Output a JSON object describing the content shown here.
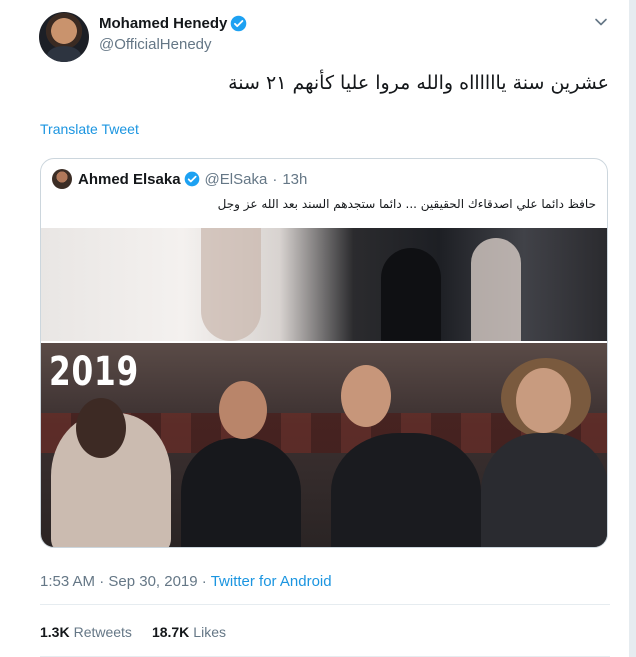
{
  "author": {
    "display_name": "Mohamed Henedy",
    "handle": "@OfficialHenedy",
    "verified_icon": "verified-badge-icon"
  },
  "tweet": {
    "text": "عشرين سنة يااااااه والله مروا عليا كأنهم ٢١ سنة",
    "translate_label": "Translate Tweet"
  },
  "quoted_tweet": {
    "display_name": "Ahmed Elsaka",
    "handle": "@ElSaka",
    "separator": "·",
    "time": "13h",
    "text": "حافظ دائما علي اصدقاءك الحقيقين ... دائما ستجدهم  السند بعد الله عز وجل",
    "media_caption": "2019"
  },
  "meta": {
    "timestamp": "1:53 AM · Sep 30, 2019",
    "separator": "·",
    "source": "Twitter for Android"
  },
  "stats": {
    "retweets_count": "1.3K",
    "retweets_label": "Retweets",
    "likes_count": "18.7K",
    "likes_label": "Likes"
  },
  "colors": {
    "link": "#1b95e0",
    "verified": "#1da1f2",
    "secondary_text": "#657786"
  }
}
